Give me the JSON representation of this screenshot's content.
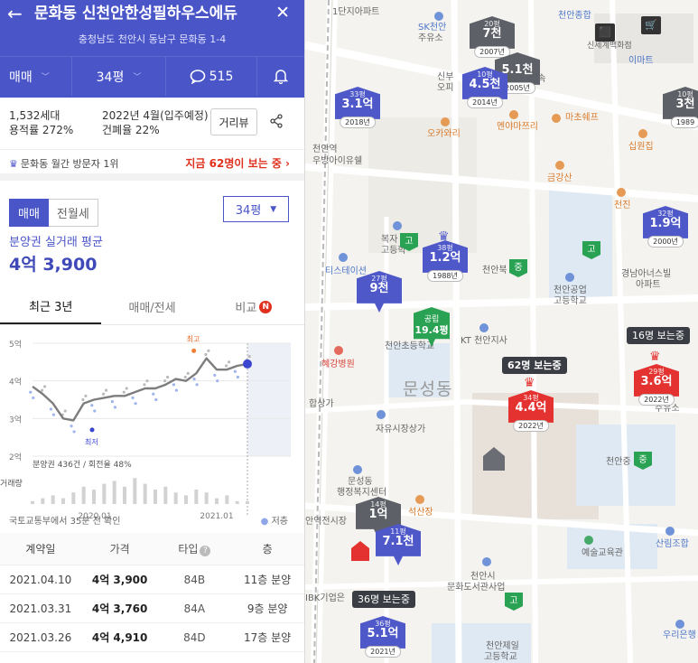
{
  "header": {
    "back_icon": "←",
    "title": "문화동 신천안한성필하우스에듀",
    "close_icon": "✕",
    "address": "충청남도 천안시 동남구 문화동 1-4",
    "trade_type": "매매",
    "size": "34평",
    "comment_count": "515"
  },
  "stats": {
    "households": "1,532세대",
    "floor_area_ratio": "용적률 272%",
    "move_in": "2022년 4월(입주예정)",
    "coverage_ratio": "건폐율 22%",
    "street_view_label": "거리뷰"
  },
  "visit": {
    "rank_text": "문화동 월간 방문자 1위",
    "viewing_now": "지금 62명이 보는 중 ›"
  },
  "trade": {
    "tabs": [
      "매매",
      "전월세"
    ],
    "size_select": "34평",
    "avg_label": "분양권 실거래 평균",
    "avg_value": "4억 3,900"
  },
  "range_tabs": [
    "최근 3년",
    "매매/전세",
    "비교"
  ],
  "compare_badge": "N",
  "chart_data": {
    "type": "line",
    "y_tick_labels": [
      "5억",
      "4억",
      "3억",
      "2억"
    ],
    "ylim": [
      2,
      5
    ],
    "x_tick_labels": [
      "2020.01",
      "2021.01"
    ],
    "annotations": {
      "max": "최고",
      "min": "최저"
    },
    "summary_text": "분양권 436건 / 회전율 48%",
    "volume_label": "거래량",
    "series": [
      {
        "values": [
          3.85,
          3.65,
          3.4,
          3.0,
          2.95,
          3.4,
          3.5,
          3.55,
          3.6,
          3.6,
          3.7,
          3.8,
          3.8,
          3.9,
          4.05,
          4.0,
          4.2,
          4.6,
          4.3,
          4.3,
          4.4,
          4.45
        ]
      }
    ],
    "volume": [
      1,
      2,
      3,
      2,
      4,
      6,
      5,
      7,
      8,
      6,
      9,
      7,
      5,
      6,
      4,
      3,
      5,
      4,
      2,
      3,
      1,
      1
    ]
  },
  "chart_foot": {
    "source": "국토교통부에서 35분 전 확인",
    "legend_low": "저층"
  },
  "table": {
    "headers": [
      "계약일",
      "가격",
      "타입",
      "층"
    ],
    "rows": [
      {
        "date": "2021.04.10",
        "price": "4억 3,900",
        "type": "84B",
        "floor": "11층 분양"
      },
      {
        "date": "2021.03.31",
        "price": "4억 3,760",
        "type": "84A",
        "floor": "9층 분양"
      },
      {
        "date": "2021.03.26",
        "price": "4억 4,910",
        "type": "84D",
        "floor": "17층 분양"
      }
    ]
  },
  "map": {
    "district": "문성동",
    "labels": [
      {
        "t": "1단지아파트",
        "c": "dark"
      },
      {
        "t": "SK천안",
        "c": "blue"
      },
      {
        "t": "주유소",
        "c": "dark"
      },
      {
        "t": "천안종합",
        "c": "blue"
      },
      {
        "t": "신세계백화점",
        "c": "dark"
      },
      {
        "t": "이마트",
        "c": "dark"
      },
      {
        "t": "신부",
        "c": "dark"
      },
      {
        "t": "오피",
        "c": "dark"
      },
      {
        "t": "고속",
        "c": "dark"
      },
      {
        "t": "오카와리",
        "c": "orange"
      },
      {
        "t": "멘야마쯔리",
        "c": "orange"
      },
      {
        "t": "마초쉐프",
        "c": "orange"
      },
      {
        "t": "십원집",
        "c": "orange"
      },
      {
        "t": "천안역",
        "c": "dark"
      },
      {
        "t": "우방아이유쉘",
        "c": "dark"
      },
      {
        "t": "금강산",
        "c": "orange"
      },
      {
        "t": "천진",
        "c": "orange"
      },
      {
        "t": "복자",
        "c": "dark"
      },
      {
        "t": "고등학",
        "c": "dark"
      },
      {
        "t": "티스테이션",
        "c": "blue"
      },
      {
        "t": "천안북",
        "c": "dark"
      },
      {
        "t": "천안공업",
        "c": "dark"
      },
      {
        "t": "고등학교",
        "c": "dark"
      },
      {
        "t": "경남아너스빌",
        "c": "dark"
      },
      {
        "t": "아파트",
        "c": "dark"
      },
      {
        "t": "천안초등학교",
        "c": "dark"
      },
      {
        "t": "KT 천안지사",
        "c": "dark"
      },
      {
        "t": "혜강병원",
        "c": "red"
      },
      {
        "t": "주유소",
        "c": "dark"
      },
      {
        "t": "합상가",
        "c": "dark"
      },
      {
        "t": "자유시장상가",
        "c": "dark"
      },
      {
        "t": "천안중",
        "c": "dark"
      },
      {
        "t": "문성동",
        "c": "dark"
      },
      {
        "t": "행정복지센터",
        "c": "dark"
      },
      {
        "t": "석산장",
        "c": "orange"
      },
      {
        "t": "안역전시장",
        "c": "dark"
      },
      {
        "t": "산림조합",
        "c": "blue"
      },
      {
        "t": "예술교육관",
        "c": "dark"
      },
      {
        "t": "천안시",
        "c": "dark"
      },
      {
        "t": "문화도서관사업",
        "c": "dark"
      },
      {
        "t": "IBK기업은",
        "c": "dark"
      },
      {
        "t": "우리은행",
        "c": "blue"
      },
      {
        "t": "천안제일",
        "c": "dark"
      },
      {
        "t": "고등학교",
        "c": "dark"
      }
    ],
    "pins": [
      {
        "color": "gray",
        "size": "20평",
        "price": "7천",
        "year": "2007년"
      },
      {
        "color": "gray",
        "size": "",
        "price": "5.1천",
        "year": "2005년"
      },
      {
        "color": "purple",
        "size": "10평",
        "price": "4.5천",
        "year": "2014년"
      },
      {
        "color": "gray",
        "size": "10평",
        "price": "3천",
        "year": "1989"
      },
      {
        "color": "purple",
        "size": "33평",
        "price": "3.1억",
        "year": "2018년"
      },
      {
        "color": "purple",
        "size": "32평",
        "price": "1.9억",
        "year": "2000년"
      },
      {
        "color": "purple",
        "size": "38평",
        "price": "1.2억",
        "year": "1988년"
      },
      {
        "color": "purple",
        "size": "27평",
        "price": "9천",
        "year": ""
      },
      {
        "color": "red",
        "size": "29평",
        "price": "3.6억",
        "year": "2022년"
      },
      {
        "color": "red",
        "size": "34평",
        "price": "4.4억",
        "year": "2022년"
      },
      {
        "color": "gray",
        "size": "14평",
        "price": "1억",
        "year": ""
      },
      {
        "color": "purple",
        "size": "11평",
        "price": "7.1천",
        "year": ""
      },
      {
        "color": "purple",
        "size": "36평",
        "price": "5.1억",
        "year": "2021년"
      }
    ],
    "green_pin": {
      "a": "공립",
      "b": "19.4평"
    },
    "school_label": "고",
    "middle_school_label": "중",
    "tooltips": [
      "16명 보는중",
      "62명 보는중",
      "36명 보는중"
    ],
    "store_label": "이마트"
  }
}
